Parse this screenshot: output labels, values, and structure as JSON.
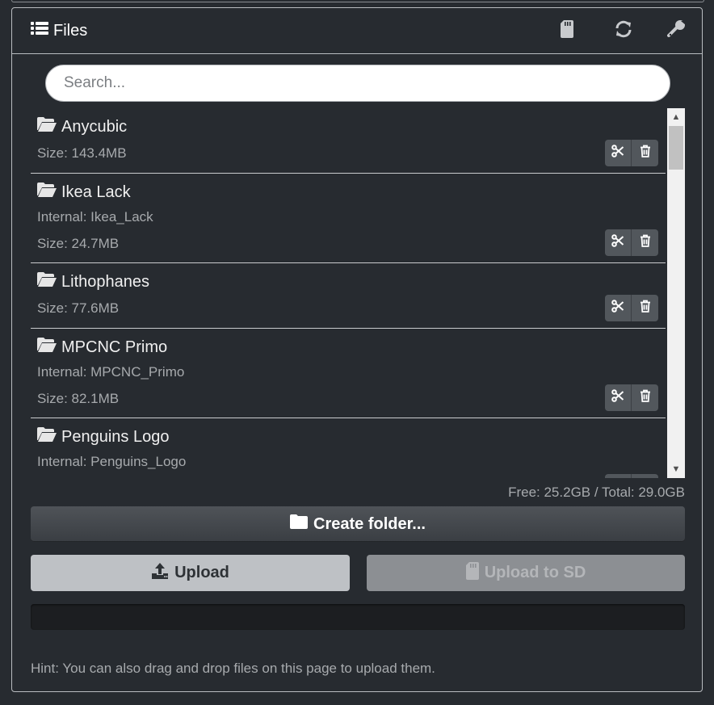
{
  "panel": {
    "title": "Files",
    "header_icons": [
      "sd-card-icon",
      "refresh-icon",
      "wrench-icon"
    ]
  },
  "search": {
    "placeholder": "Search...",
    "value": ""
  },
  "files": [
    {
      "name": "Anycubic",
      "size": "Size: 143.4MB"
    },
    {
      "name": "Ikea Lack",
      "internal": "Internal: Ikea_Lack",
      "size": "Size: 24.7MB"
    },
    {
      "name": "Lithophanes",
      "size": "Size: 77.6MB"
    },
    {
      "name": "MPCNC Primo",
      "internal": "Internal: MPCNC_Primo",
      "size": "Size: 82.1MB"
    },
    {
      "name": "Penguins Logo",
      "internal": "Internal: Penguins_Logo"
    }
  ],
  "storage": {
    "free_total": "Free: 25.2GB / Total: 29.0GB"
  },
  "buttons": {
    "create_folder": "Create folder...",
    "upload": "Upload",
    "upload_sd": "Upload to SD"
  },
  "upload_progress": 0,
  "hint": "Hint: You can also drag and drop files on this page to upload them.",
  "colors": {
    "background": "#272b30",
    "panel_border": "#b9bcc0",
    "upload_button": "#bec1c5",
    "upload_sd_disabled": "#8c8f93"
  }
}
